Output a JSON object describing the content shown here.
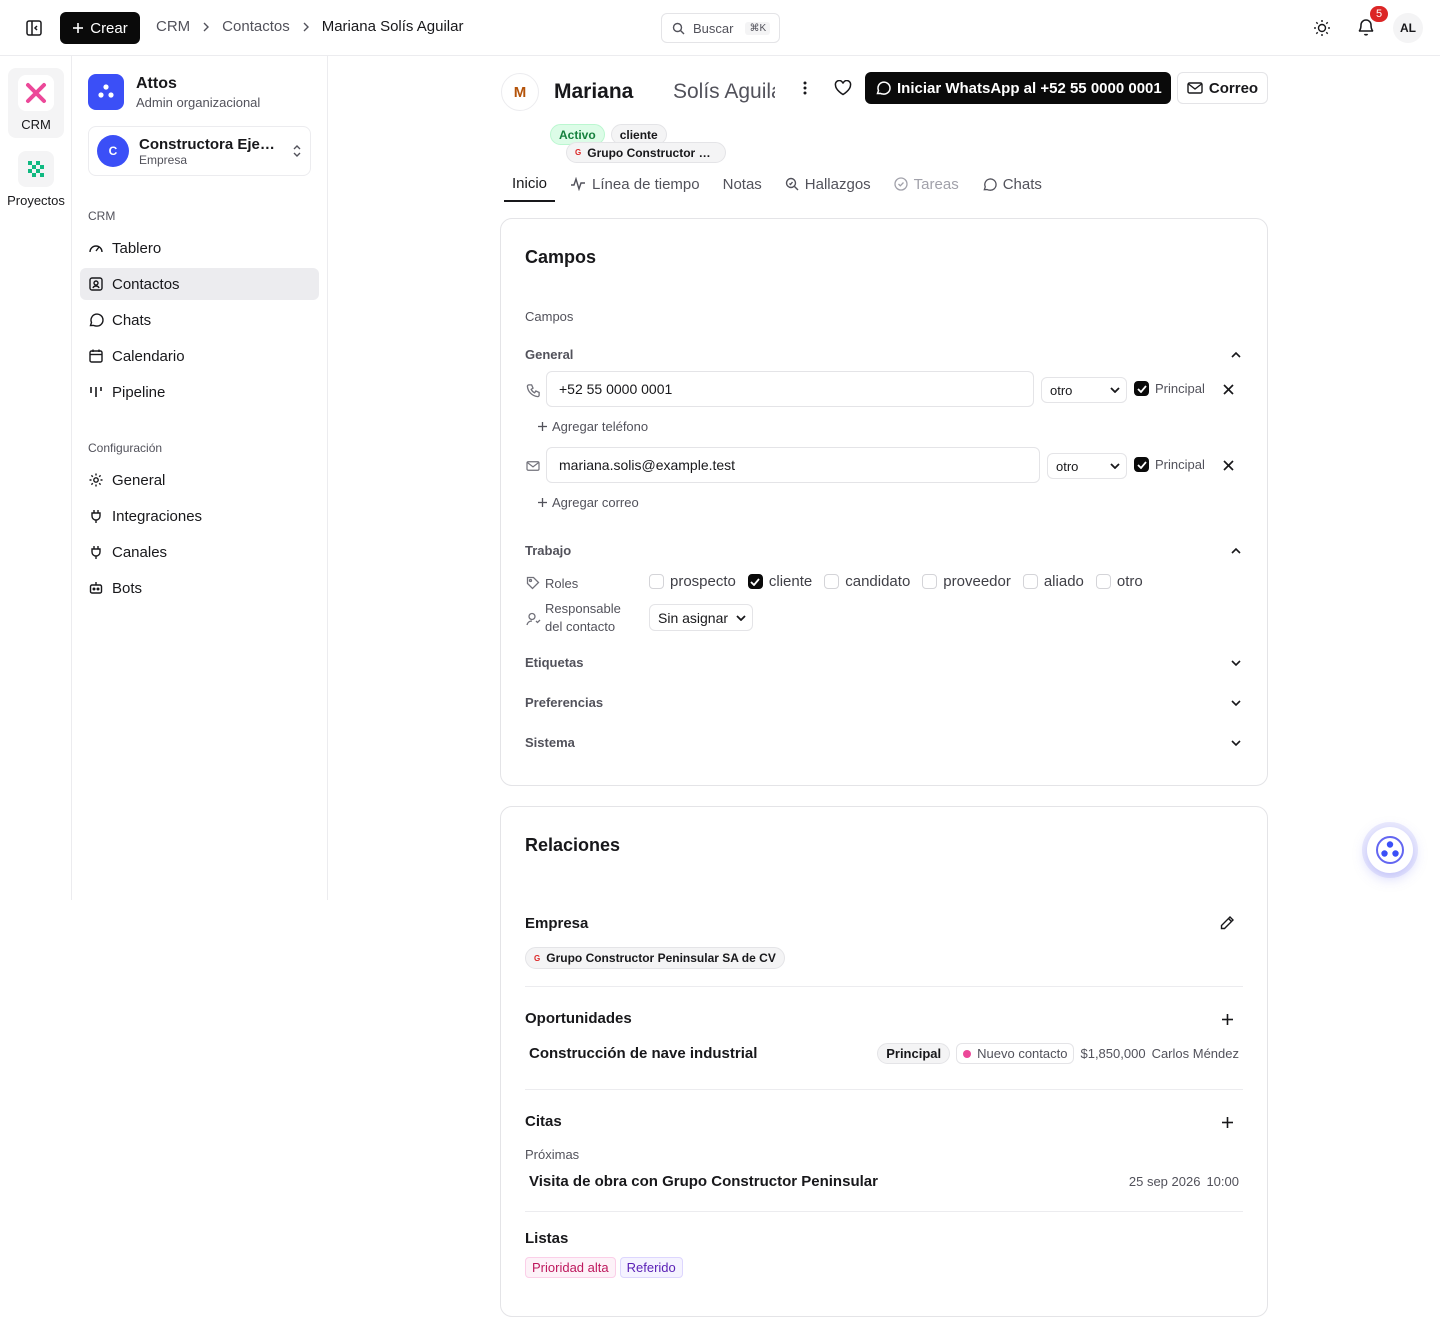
{
  "topbar": {
    "create_label": "Crear",
    "breadcrumb": [
      "CRM",
      "Contactos",
      "Mariana Solís Aguilar"
    ],
    "search_label": "Buscar",
    "search_shortcut": "⌘K",
    "notifications_count": "5",
    "user_initials": "AL"
  },
  "rail": {
    "items": [
      {
        "label": "CRM",
        "icon": "crm-logo-icon",
        "active": true
      },
      {
        "label": "Proyectos",
        "icon": "projects-logo-icon",
        "active": false
      }
    ]
  },
  "sidebar": {
    "org_name": "Attos",
    "org_role": "Admin organizacional",
    "company_initial": "C",
    "company_name": "Constructora Ejemplo",
    "company_type": "Empresa",
    "section_crm": "CRM",
    "crm_items": [
      {
        "label": "Tablero",
        "icon": "gauge-icon"
      },
      {
        "label": "Contactos",
        "icon": "contact-card-icon",
        "active": true
      },
      {
        "label": "Chats",
        "icon": "chat-bubble-icon"
      },
      {
        "label": "Calendario",
        "icon": "calendar-icon"
      },
      {
        "label": "Pipeline",
        "icon": "pipeline-icon"
      }
    ],
    "section_config": "Configuración",
    "config_items": [
      {
        "label": "General",
        "icon": "gear-icon"
      },
      {
        "label": "Integraciones",
        "icon": "plug-icon"
      },
      {
        "label": "Canales",
        "icon": "plug-icon"
      },
      {
        "label": "Bots",
        "icon": "bot-icon"
      }
    ]
  },
  "contact": {
    "initial": "M",
    "first_name": "Mariana",
    "last_name": "Solís Aguilar",
    "whatsapp_label": "Iniciar WhatsApp al +52 55 0000 0001",
    "email_label": "Correo",
    "org_chip": "Grupo Constructor Peninsular SA de CV",
    "org_chip_initial": "G",
    "status_chip": "Activo",
    "role_chip": "cliente"
  },
  "tabs": [
    {
      "label": "Inicio",
      "icon": "",
      "active": true
    },
    {
      "label": "Línea de tiempo",
      "icon": "activity-icon"
    },
    {
      "label": "Notas",
      "icon": ""
    },
    {
      "label": "Hallazgos",
      "icon": "search-insight-icon"
    },
    {
      "label": "Tareas",
      "icon": "check-circle-icon",
      "disabled": true
    },
    {
      "label": "Chats",
      "icon": "chat-bubble-icon"
    }
  ],
  "fields": {
    "title": "Campos",
    "subtitle": "Campos",
    "general_label": "General",
    "phone_value": "+52 55 0000 0001",
    "phone_type": "otro",
    "principal_label": "Principal",
    "add_phone": "Agregar teléfono",
    "email_value": "mariana.solis@example.test",
    "email_type": "otro",
    "add_email": "Agregar correo",
    "work_label": "Trabajo",
    "roles_label": "Roles",
    "roles": [
      {
        "label": "prospecto",
        "checked": false
      },
      {
        "label": "cliente",
        "checked": true
      },
      {
        "label": "candidato",
        "checked": false
      },
      {
        "label": "proveedor",
        "checked": false
      },
      {
        "label": "aliado",
        "checked": false
      },
      {
        "label": "otro",
        "checked": false
      }
    ],
    "owner_label_1": "Responsable",
    "owner_label_2": "del contacto",
    "owner_value": "Sin asignar",
    "tags_label": "Etiquetas",
    "prefs_label": "Preferencias",
    "system_label": "Sistema"
  },
  "relations": {
    "title": "Relaciones",
    "company_label": "Empresa",
    "company_value": "Grupo Constructor Peninsular SA de CV",
    "company_initial": "G",
    "opps_label": "Oportunidades",
    "opp_name": "Construcción de nave industrial",
    "opp_tag": "Principal",
    "opp_stage": "Nuevo contacto",
    "opp_amount": "$1,850,000",
    "opp_owner": "Carlos Méndez",
    "appts_label": "Citas",
    "upcoming_label": "Próximas",
    "appt_name": "Visita de obra con Grupo Constructor Peninsular",
    "appt_date": "25 sep 2026",
    "appt_time": "10:00",
    "lists_label": "Listas",
    "lists": [
      {
        "label": "Prioridad alta",
        "bg": "#fdf2f8",
        "color": "#be185d",
        "border": "#fbcfe8"
      },
      {
        "label": "Referido",
        "bg": "#f5f3ff",
        "color": "#5b21b6",
        "border": "#ddd6fe"
      }
    ]
  }
}
